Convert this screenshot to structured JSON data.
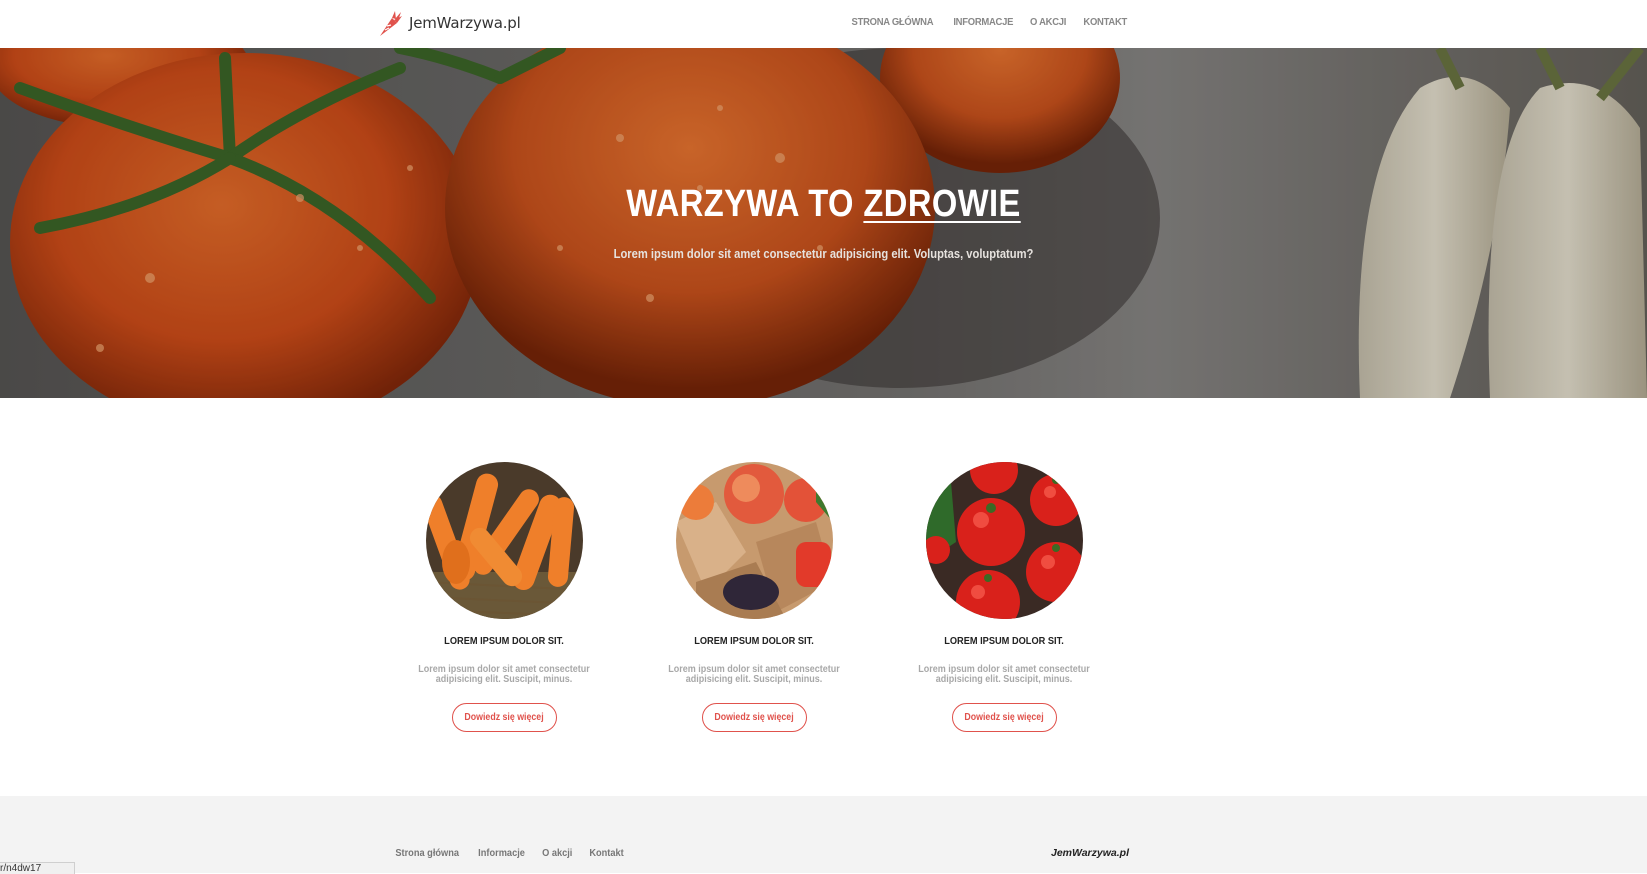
{
  "header": {
    "logo_text": "JemWarzywa.pl",
    "nav": [
      "STRONA GŁÓWNA",
      "INFORMACJE",
      "O AKCJI",
      "KONTAKT"
    ]
  },
  "hero": {
    "title_part1": "WARZYWA TO ",
    "title_part2": "ZDROWIE",
    "subtitle": "Lorem ipsum dolor sit amet consectetur adipisicing elit. Voluptas, voluptatum?"
  },
  "cards": [
    {
      "image": "carrots-image",
      "title": "LOREM IPSUM DOLOR SIT.",
      "text": "Lorem ipsum dolor sit amet consectetur adipisicing elit. Suscipit, minus.",
      "button": "Dowiedz się więcej"
    },
    {
      "image": "mixed-produce-image",
      "title": "LOREM IPSUM DOLOR SIT.",
      "text": "Lorem ipsum dolor sit amet consectetur adipisicing elit. Suscipit, minus.",
      "button": "Dowiedz się więcej"
    },
    {
      "image": "tomatoes-image",
      "title": "LOREM IPSUM DOLOR SIT.",
      "text": "Lorem ipsum dolor sit amet consectetur adipisicing elit. Suscipit, minus.",
      "button": "Dowiedz się więcej"
    }
  ],
  "footer": {
    "nav": [
      "Strona główna",
      "Informacje",
      "O akcji",
      "Kontakt"
    ],
    "brand": "JemWarzywa.pl"
  },
  "status_bar": {
    "text": "r/n4dw17"
  },
  "colors": {
    "accent": "#e0524c",
    "footer_bg": "#f3f3f3",
    "nav_text": "#888888"
  }
}
